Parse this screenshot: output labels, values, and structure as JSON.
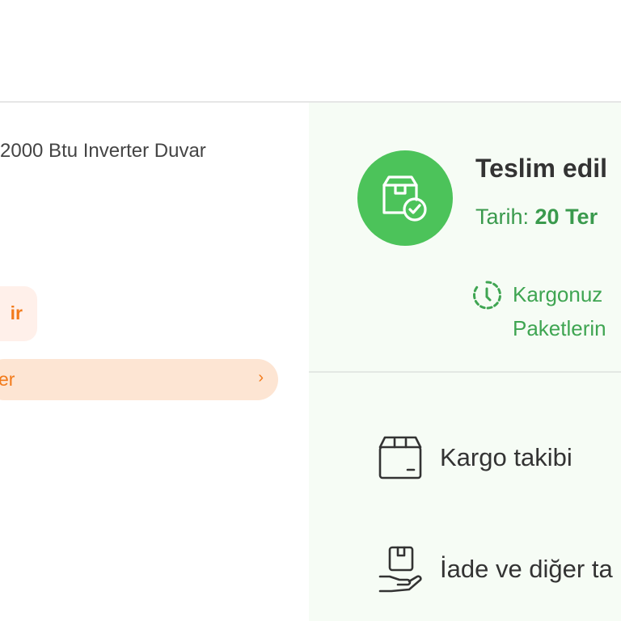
{
  "product": {
    "name": "2000 Btu Inverter Duvar",
    "badge_text": "ir",
    "pill_text": "er",
    "pill_chevron": "›"
  },
  "delivery": {
    "status_title": "Teslim edil",
    "date_label": "Tarih: ",
    "date_value": "20 Ter",
    "info_line1": "Kargonuz",
    "info_line2": "Paketlerin"
  },
  "actions": [
    {
      "label": "Kargo takibi",
      "icon": "box-icon"
    },
    {
      "label": "İade ve diğer ta",
      "icon": "hand-box-icon"
    }
  ],
  "colors": {
    "accent_green": "#4cc35a",
    "text_green": "#3fa552",
    "accent_orange": "#f27a1a",
    "panel_bg": "#f6fcf5"
  }
}
